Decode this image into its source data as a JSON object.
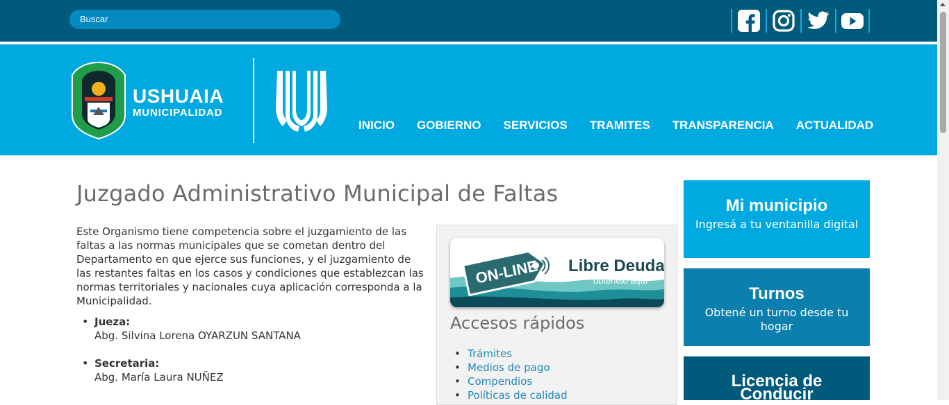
{
  "search": {
    "placeholder": "Buscar"
  },
  "social": [
    "facebook-icon",
    "instagram-icon",
    "twitter-icon",
    "youtube-icon"
  ],
  "brand": {
    "line1": "USHUAIA",
    "line2": "MUNICIPALIDAD"
  },
  "nav": [
    "INICIO",
    "GOBIERNO",
    "SERVICIOS",
    "TRAMITES",
    "TRANSPARENCIA",
    "ACTUALIDAD"
  ],
  "main": {
    "title": "Juzgado Administrativo Municipal de Faltas",
    "intro": "Este Organismo tiene competencia sobre el juzgamiento de las faltas a las normas municipales que se cometan dentro del Departamento en que ejerce sus funciones, y el juzgamiento de las restantes faltas en los casos y condiciones que establezcan las normas territoriales y nacionales cuya aplicación corresponda a la Municipalidad.",
    "people": [
      {
        "role": "Jueza:",
        "name": "Abg. Silvina Lorena OYARZUN SANTANA"
      },
      {
        "role": "Secretaria:",
        "name": "Abg. María Laura NUÑEZ"
      }
    ]
  },
  "banner": {
    "tag": "ON-LINE",
    "title": "Libre Deuda",
    "sub": "obtenelo aquí"
  },
  "quick": {
    "title": "Accesos rápidos",
    "links": [
      "Trámites",
      "Medios de pago",
      "Compendios",
      "Políticas de calidad"
    ]
  },
  "cards": [
    {
      "title": "Mi municipio",
      "sub": "Ingresá a tu ventanilla digital",
      "color": "#00a9e0"
    },
    {
      "title": "Turnos",
      "sub": "Obtené un turno desde tu hogar",
      "color": "#0b7fae"
    },
    {
      "title": "Licencia de Conducir",
      "sub": "",
      "color": "#005a7c"
    }
  ],
  "colors": {
    "topbar": "#005a7c",
    "header": "#00a9e0",
    "search": "#0489c0",
    "link": "#1e88b8"
  }
}
